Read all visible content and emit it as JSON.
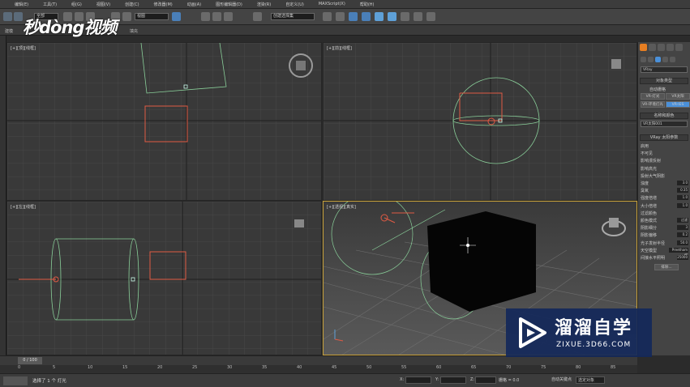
{
  "menu": [
    "编辑(E)",
    "工具(T)",
    "组(G)",
    "视图(V)",
    "创建(C)",
    "修改器(M)",
    "动画(A)",
    "图形编辑器(D)",
    "渲染(R)",
    "自定义(U)",
    "MAXScript(X)",
    "帮助(H)"
  ],
  "toolbar": {
    "filter_value": "全部",
    "view_value": "视图",
    "selection_set": "创建选择集"
  },
  "ribbon": {
    "left": "建模",
    "center": "填充"
  },
  "logo_text": "秒dòng视频",
  "viewports": {
    "top": "[+][顶][线框]",
    "front": "[+][前][线框]",
    "left": "[+][左][线框]",
    "perspective": "[+][透视][真实]"
  },
  "command_panel": {
    "renderer": "VRay",
    "object_type": "对象类型",
    "autogrid": "自动栅格",
    "btn_light": "VR-灯光",
    "btn_sun": "VR太阳",
    "btn_ies": "VR-IES",
    "btn_ambient": "VR-环境灯光",
    "name_color": "名称和颜色",
    "name_value": "VR太阳001",
    "sun_params": "VRay 太阳参数",
    "params": [
      {
        "label": "启用",
        "value": ""
      },
      {
        "label": "不可见",
        "value": ""
      },
      {
        "label": "影响漫反射",
        "value": ""
      },
      {
        "label": "影响高光",
        "value": ""
      },
      {
        "label": "投射大气阴影",
        "value": ""
      },
      {
        "label": "浊度",
        "value": "3.0"
      },
      {
        "label": "臭氧",
        "value": "0.35"
      },
      {
        "label": "强度倍增",
        "value": "1.0"
      },
      {
        "label": "大小倍增",
        "value": "1.0"
      },
      {
        "label": "过滤颜色",
        "value": ""
      },
      {
        "label": "颜色模式",
        "value": "过滤"
      },
      {
        "label": "阴影细分",
        "value": "3"
      },
      {
        "label": "阴影偏移",
        "value": "0.2"
      },
      {
        "label": "光子发射半径",
        "value": "50.0"
      },
      {
        "label": "天空模型",
        "value": "Preetham et"
      },
      {
        "label": "间接水平照明",
        "value": "25000"
      }
    ],
    "exclude": "排除..."
  },
  "timeline": {
    "frame_label": "0 / 100",
    "ticks": [
      "0",
      "5",
      "10",
      "15",
      "20",
      "25",
      "30",
      "35",
      "40",
      "45",
      "50",
      "55",
      "60",
      "65",
      "70",
      "75",
      "80",
      "85"
    ]
  },
  "status": {
    "message": "选择了 1 个 灯光",
    "x_label": "X:",
    "y_label": "Y:",
    "z_label": "Z:",
    "grid": "栅格 = 0.0",
    "auto_key": "自动关键点",
    "selected": "选定对象"
  },
  "watermark": {
    "main": "溜溜自学",
    "sub": "ZIXUE.3D66.COM"
  },
  "colors": {
    "grid": "#4a4a4a",
    "gizmo_green": "#9fe0a8",
    "gizmo_red": "#e05a44",
    "accent": "#e67e22",
    "highlight": "#4a90d9"
  }
}
